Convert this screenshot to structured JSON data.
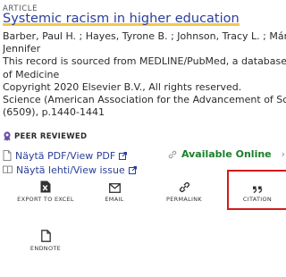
{
  "type_label": "ARTICLE",
  "title": "Systemic racism in higher education",
  "meta_lines": [
    "Barber, Paul H. ; Hayes, Tyrone B. ; Johnson, Tracy L. ; Márque",
    "Jennifer",
    "This record is sourced from MEDLINE/PubMed, a database of",
    "of Medicine",
    "Copyright 2020 Elsevier B.V., All rights reserved.",
    "Science (American Association for the Advancement of Scienc",
    "(6509), p.1440-1441"
  ],
  "peer_reviewed": "PEER REVIEWED",
  "links": {
    "pdf": "Näytä PDF/View PDF",
    "issue": "Näytä lehti/View issue"
  },
  "availability": "Available Online",
  "actions": {
    "excel": "EXPORT TO EXCEL",
    "email": "EMAIL",
    "permalink": "PERMALINK",
    "citation": "CITATION",
    "endnote": "ENDNOTE"
  },
  "colors": {
    "link": "#2c3e9a",
    "available": "#1a7f2a",
    "highlight": "#f2c94c",
    "citation_border": "#d21a1a"
  }
}
